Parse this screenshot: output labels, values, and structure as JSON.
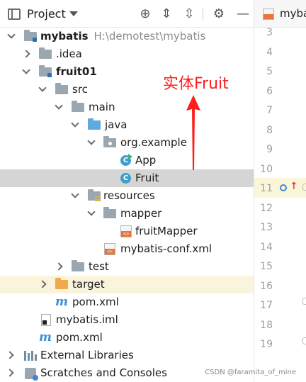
{
  "toolbar": {
    "title": "Project"
  },
  "tree": {
    "root_label": "mybatis",
    "root_path": "H:\\demotest\\mybatis",
    "idea": ".idea",
    "module": "fruit01",
    "src": "src",
    "main": "main",
    "java": "java",
    "package": "org.example",
    "app": "App",
    "fruit": "Fruit",
    "resources": "resources",
    "mapper": "mapper",
    "fruit_mapper": "fruitMapper",
    "mybatis_conf": "mybatis-conf.xml",
    "test": "test",
    "target": "target",
    "module_pom": "pom.xml",
    "iml": "mybatis.iml",
    "root_pom": "pom.xml",
    "external_libraries": "External Libraries",
    "scratches": "Scratches and Consoles"
  },
  "annotation": {
    "text": "实体Fruit",
    "color": "#ff1e1e"
  },
  "editor": {
    "tab_label": "myba",
    "line_numbers": [
      "3",
      "4",
      "5",
      "6",
      "7",
      "8",
      "9",
      "10",
      "11",
      "12",
      "13",
      "14",
      "15",
      "16",
      "17",
      "18",
      "19"
    ],
    "highlighted_line": "11"
  },
  "watermark": "CSDN @faramita_of_mine",
  "colors": {
    "selection": "#d5d5d5",
    "excluded_row": "#fbf4dd",
    "folder_blue": "#5fa8e0",
    "folder_orange": "#f2a94a",
    "folder_gray": "#9aa7b0"
  }
}
